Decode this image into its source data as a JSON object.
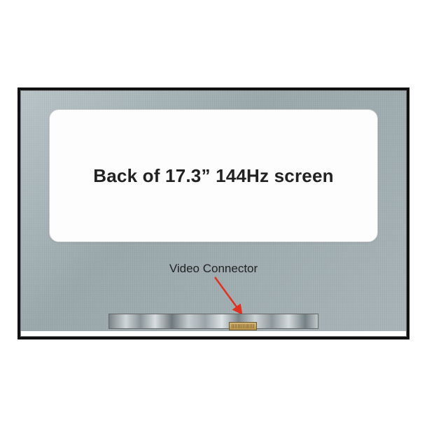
{
  "main_label": "Back of 17.3” 144Hz screen",
  "connector_label": "Video Connector",
  "colors": {
    "arrow": "#e03020"
  }
}
